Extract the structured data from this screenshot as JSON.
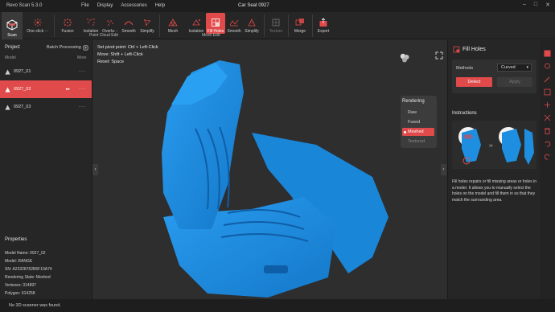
{
  "app": {
    "name": "Revo Scan 5.3.0",
    "document_title": "Car Seat 0927"
  },
  "menu": [
    "File",
    "Display",
    "Accessories",
    "Help"
  ],
  "window_controls": [
    "–",
    "□",
    "✕"
  ],
  "toolbar": {
    "scan_label": "Scan",
    "one_click_label": "One-click ···",
    "point_cloud_group": "Point Cloud Edit",
    "point_cloud_items": [
      "Fusion",
      "Isolation",
      "Overla···",
      "Smooth",
      "Simplify"
    ],
    "mesh_edit_group": "Mesh Edit",
    "mesh_items": [
      "Mesh",
      "Isolation",
      "Fill Holes",
      "Smooth",
      "Simplify"
    ],
    "texture_label": "Texture",
    "merge_label": "Merge",
    "export_label": "Export"
  },
  "left_panel": {
    "title": "Project",
    "batch_label": "Batch Processing",
    "col_model": "Model",
    "col_more": "More",
    "models": [
      {
        "name": "0927_01",
        "suffix": "",
        "selected": false
      },
      {
        "name": "0927_02",
        "suffix": "▸▸",
        "selected": true
      },
      {
        "name": "0927_03",
        "suffix": "",
        "selected": false
      }
    ],
    "more_glyph": "···",
    "properties_title": "Properties",
    "properties": [
      {
        "label": "Model Name:",
        "value": "0927_02"
      },
      {
        "label": "Model:",
        "value": "RANGE"
      },
      {
        "label": "SN:",
        "value": "A23328762B6F10A74"
      },
      {
        "label": "Rendering State:",
        "value": "Meshed"
      },
      {
        "label": "Vertexes:",
        "value": "314897"
      },
      {
        "label": "Polygon:",
        "value": "614258"
      }
    ]
  },
  "viewport": {
    "hints": [
      "Set pivot point: Ctrl + Left-Click",
      "Move: Shift + Left-Click",
      "Reset: Space"
    ],
    "rendering_title": "Rendering",
    "rendering_options": [
      {
        "label": "Raw",
        "state": "normal"
      },
      {
        "label": "Fused",
        "state": "normal"
      },
      {
        "label": "Meshed",
        "state": "selected"
      },
      {
        "label": "Textured",
        "state": "disabled"
      }
    ],
    "left_arrow": "‹",
    "right_arrow": "›"
  },
  "right_panel": {
    "title": "Fill Holes",
    "methods_label": "Methods",
    "method_value": "Curved",
    "detect_label": "Detect",
    "apply_label": "Apply",
    "instructions_title": "Instructions",
    "instructions_text": "Fill holes repairs or fill missing areas or holes in a model. It allows you to manually select the holes on the model and fill them in so that they match the surrounding area.",
    "arrow_glyph": "››"
  },
  "status": {
    "text": "No 3D scanner was found."
  },
  "colors": {
    "accent": "#e04a4a",
    "model": "#1e8fe0"
  }
}
